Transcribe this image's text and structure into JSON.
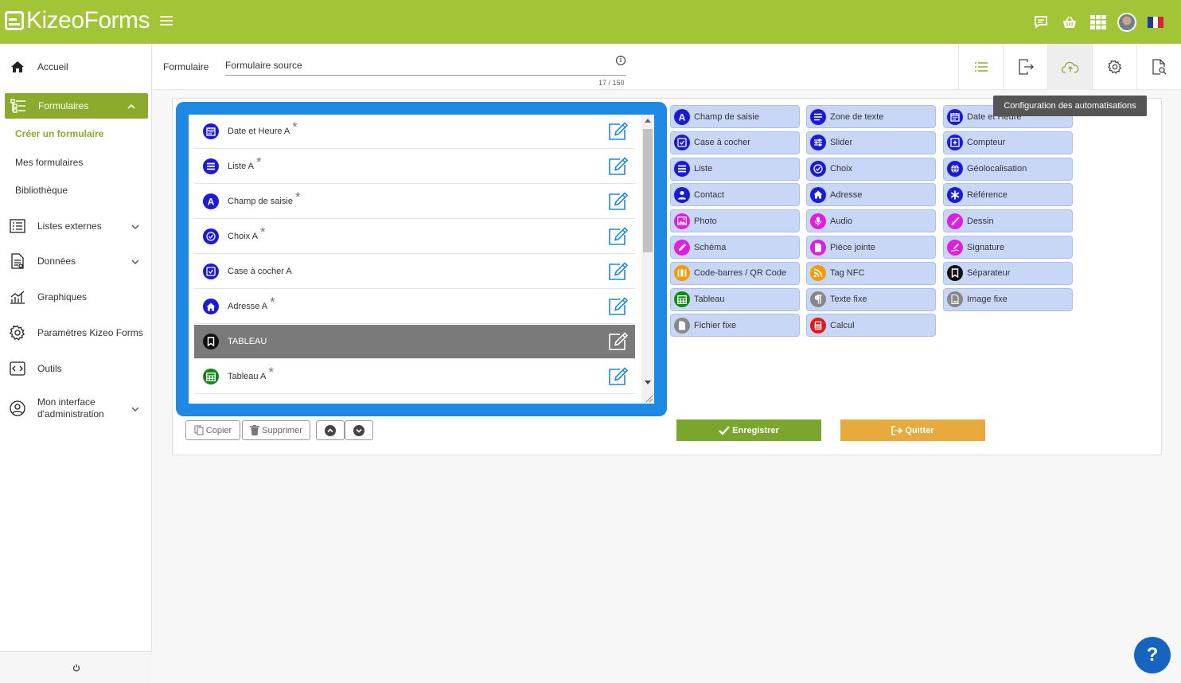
{
  "app": {
    "logo_text": "KizeoForms",
    "brand_color": "#a2c437",
    "accent_color": "#8bab2c"
  },
  "topbar": {
    "icons": [
      "chat-icon",
      "basket-icon",
      "grid-apps-icon",
      "avatar",
      "france-flag-icon"
    ]
  },
  "sidebar": {
    "items": [
      {
        "label": "Accueil",
        "icon": "home-icon"
      },
      {
        "label": "Formulaires",
        "icon": "forms-icon"
      },
      {
        "label": "Listes externes",
        "icon": "list-icon"
      },
      {
        "label": "Données",
        "icon": "data-icon"
      },
      {
        "label": "Graphiques",
        "icon": "chart-icon"
      },
      {
        "label": "Paramètres Kizeo Forms",
        "icon": "gear-icon"
      },
      {
        "label": "Outils",
        "icon": "code-icon"
      },
      {
        "label": "Mon interface d'administration",
        "icon": "admin-icon"
      }
    ],
    "sub_items": [
      {
        "label": "Créer un formulaire"
      },
      {
        "label": "Mes formulaires"
      },
      {
        "label": "Bibliothèque"
      }
    ]
  },
  "formbar": {
    "label": "Formulaire",
    "input_value": "Formulaire source",
    "char_count": "17 / 150",
    "tabs": [
      "list-icon",
      "export-icon",
      "cloud-upload-icon",
      "settings-icon",
      "document-search-icon"
    ],
    "tooltip": "Configuration des automatisations"
  },
  "fields": [
    {
      "label": "Date et Heure A",
      "required": true,
      "icon": "calendar-icon",
      "color": "#1a1adf"
    },
    {
      "label": "Liste A",
      "required": true,
      "icon": "list-icon",
      "color": "#1a1adf"
    },
    {
      "label": "Champ de saisie",
      "required": true,
      "icon": "text-a-icon",
      "color": "#1a1adf"
    },
    {
      "label": "Choix A",
      "required": true,
      "icon": "check-circle-icon",
      "color": "#1a1adf"
    },
    {
      "label": "Case à cocher A",
      "required": false,
      "icon": "checkbox-icon",
      "color": "#1a1adf"
    },
    {
      "label": "Adresse A",
      "required": true,
      "icon": "home-icon",
      "color": "#1a1adf"
    },
    {
      "label": "TABLEAU",
      "required": false,
      "icon": "bookmark-icon",
      "color": "#111111"
    },
    {
      "label": "Tableau A",
      "required": true,
      "icon": "table-icon",
      "color": "#128a12"
    }
  ],
  "star": "*",
  "buttons": {
    "copy": "Copier",
    "delete": "Supprimer",
    "save": "Enregistrer",
    "quit": "Quitter"
  },
  "palette": [
    {
      "label": "Champ de saisie",
      "icon": "text-a-icon",
      "color": "#1a1adf"
    },
    {
      "label": "Zone de texte",
      "icon": "text-area-icon",
      "color": "#1a1adf"
    },
    {
      "label": "Date et Heure",
      "icon": "calendar-icon",
      "color": "#1a1adf"
    },
    {
      "label": "Case à cocher",
      "icon": "checkbox-icon",
      "color": "#1a1adf"
    },
    {
      "label": "Slider",
      "icon": "slider-icon",
      "color": "#1a1adf"
    },
    {
      "label": "Compteur",
      "icon": "counter-icon",
      "color": "#1a1adf"
    },
    {
      "label": "Liste",
      "icon": "list-icon",
      "color": "#1a1adf"
    },
    {
      "label": "Choix",
      "icon": "check-circle-icon",
      "color": "#1a1adf"
    },
    {
      "label": "Géolocalisation",
      "icon": "globe-icon",
      "color": "#1a1adf"
    },
    {
      "label": "Contact",
      "icon": "user-icon",
      "color": "#1a1adf"
    },
    {
      "label": "Adresse",
      "icon": "home-icon",
      "color": "#1a1adf"
    },
    {
      "label": "Référence",
      "icon": "asterisk-icon",
      "color": "#1a1adf"
    },
    {
      "label": "Photo",
      "icon": "photo-icon",
      "color": "#e11de1"
    },
    {
      "label": "Audio",
      "icon": "microphone-icon",
      "color": "#e11de1"
    },
    {
      "label": "Dessin",
      "icon": "brush-icon",
      "color": "#e11de1"
    },
    {
      "label": "Schéma",
      "icon": "pencil-icon",
      "color": "#e11de1"
    },
    {
      "label": "Pièce jointe",
      "icon": "file-icon",
      "color": "#e11de1"
    },
    {
      "label": "Signature",
      "icon": "signature-icon",
      "color": "#e11de1"
    },
    {
      "label": "Code-barres / QR Code",
      "icon": "barcode-icon",
      "color": "#f59b00"
    },
    {
      "label": "Tag NFC",
      "icon": "rss-icon",
      "color": "#f59b00"
    },
    {
      "label": "Séparateur",
      "icon": "bookmark-icon",
      "color": "#111111"
    },
    {
      "label": "Tableau",
      "icon": "table-icon",
      "color": "#128a12"
    },
    {
      "label": "Texte fixe",
      "icon": "paragraph-icon",
      "color": "#888888"
    },
    {
      "label": "Image fixe",
      "icon": "image-file-icon",
      "color": "#888888"
    },
    {
      "label": "Fichier fixe",
      "icon": "file-icon",
      "color": "#888888"
    },
    {
      "label": "Calcul",
      "icon": "calculator-icon",
      "color": "#e01818"
    }
  ],
  "help": "?"
}
